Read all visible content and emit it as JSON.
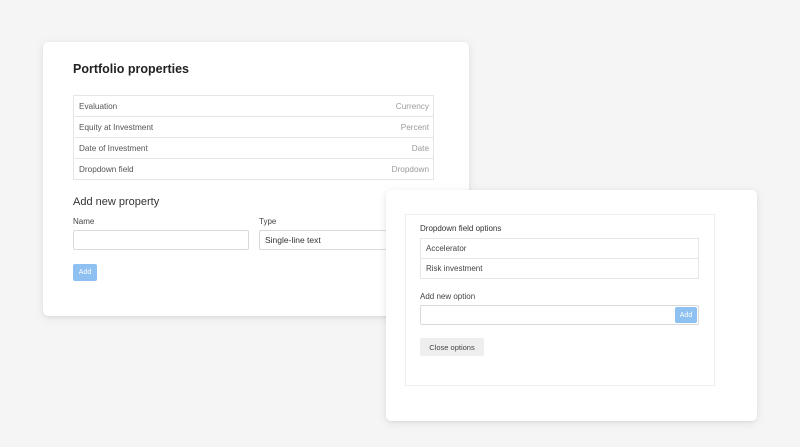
{
  "portfolio": {
    "title": "Portfolio properties",
    "properties": [
      {
        "name": "Evaluation",
        "type": "Currency"
      },
      {
        "name": "Equity at Investment",
        "type": "Percent"
      },
      {
        "name": "Date of Investment",
        "type": "Date"
      },
      {
        "name": "Dropdown field",
        "type": "Dropdown"
      }
    ],
    "add_section": {
      "title": "Add new property",
      "name_label": "Name",
      "name_value": "",
      "type_label": "Type",
      "type_value": "Single-line text",
      "add_button": "Add"
    }
  },
  "dropdown_options": {
    "title": "Dropdown field options",
    "options": [
      "Accelerator",
      "Risk investment"
    ],
    "new_option_label": "Add new option",
    "new_option_value": "",
    "add_button": "Add",
    "close_button": "Close options"
  },
  "colors": {
    "background": "#f5f5f5",
    "card": "#ffffff",
    "primary_button": "#8ec0f1",
    "secondary_button": "#eeeeee",
    "border": "#e6e6e6"
  }
}
